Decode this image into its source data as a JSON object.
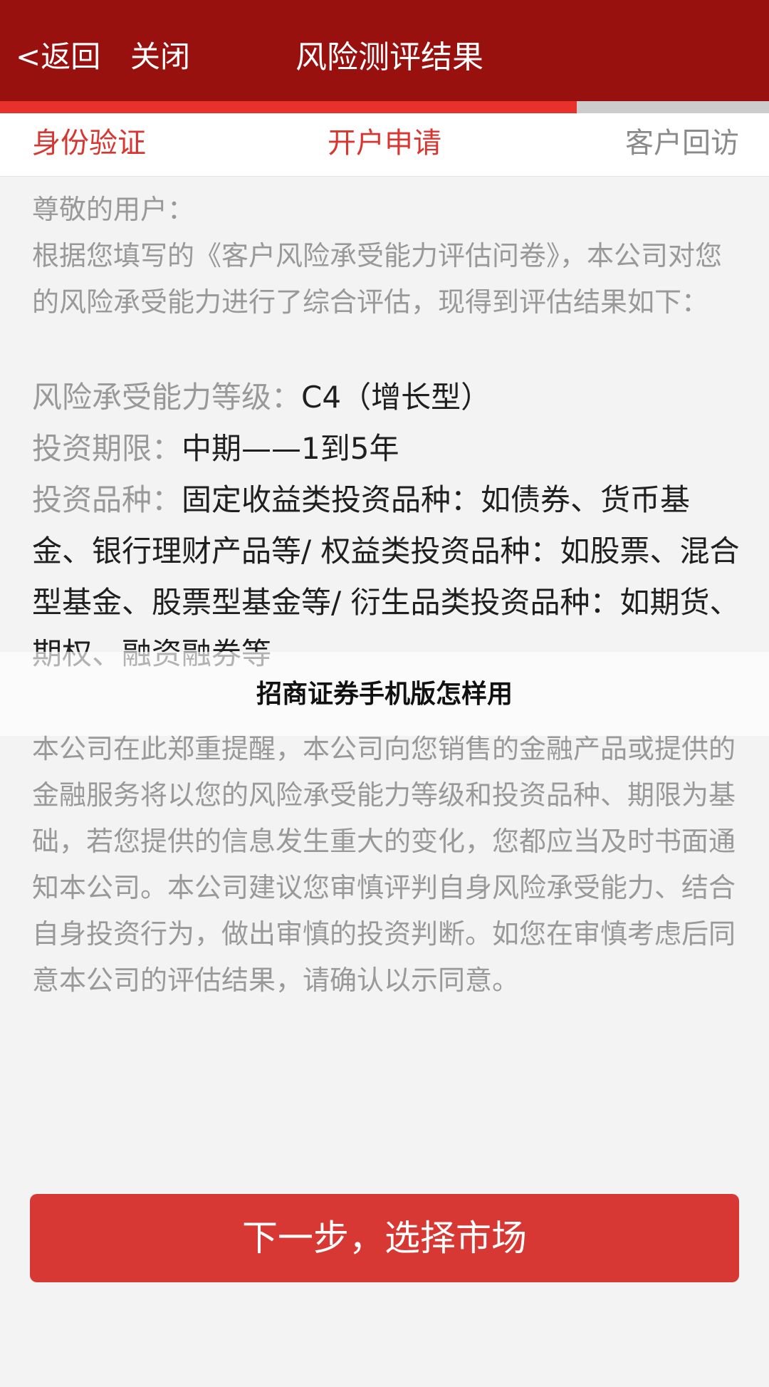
{
  "header": {
    "back_label": "<返回",
    "close_label": "关闭",
    "title": "风险测评结果"
  },
  "progress": {
    "fraction": 0.75
  },
  "steps": [
    {
      "label": "身份验证"
    },
    {
      "label": "开户申请"
    },
    {
      "label": "客户回访"
    }
  ],
  "content": {
    "greeting": "尊敬的用户：",
    "intro": "根据您填写的《客户风险承受能力评估问卷》，本公司对您的风险承受能力进行了综合评估，现得到评估结果如下：",
    "risk_level_label": "风险承受能力等级：",
    "risk_level_value": "C4（增长型）",
    "term_label": "投资期限：",
    "term_value": "中期——1到5年",
    "variety_label": "投资品种：",
    "variety_value": "固定收益类投资品种：如债券、货币基金、银行理财产品等/ 权益类投资品种：如股票、混合型基金、股票型基金等/ 衍生品类投资品种：如期货、期权、融资融券等",
    "reminder": "本公司在此郑重提醒，本公司向您销售的金融产品或提供的金融服务将以您的风险承受能力等级和投资品种、期限为基础，若您提供的信息发生重大的变化，您都应当及时书面通知本公司。本公司建议您审慎评判自身风险承受能力、结合自身投资行为，做出审慎的投资判断。如您在审慎考虑后同意本公司的评估结果，请确认以示同意。"
  },
  "overlay": {
    "text": "招商证券手机版怎样用"
  },
  "next_button": {
    "label": "下一步，选择市场"
  },
  "colors": {
    "header_bg": "#99110f",
    "accent": "#d73631",
    "progress_fill": "#e9312b",
    "progress_track": "#cccccc"
  }
}
